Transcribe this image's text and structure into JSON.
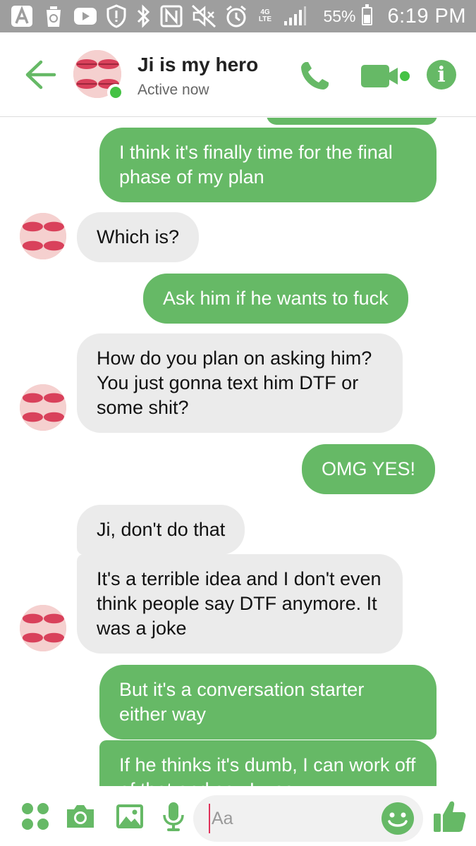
{
  "status_bar": {
    "battery_pct": "55%",
    "time": "6:19 PM",
    "network_label": "4G LTE"
  },
  "header": {
    "contact_name": "Ji is my hero",
    "contact_status": "Active now"
  },
  "messages": [
    {
      "side": "out",
      "text": "I think it's finally time for the final phase of my plan"
    },
    {
      "side": "in",
      "text": "Which is?"
    },
    {
      "side": "out",
      "text": "Ask him if he wants to fuck"
    },
    {
      "side": "in",
      "text": "How do you plan on asking him? You just gonna text him DTF or some shit?"
    },
    {
      "side": "out",
      "text": "OMG YES!"
    },
    {
      "side": "in",
      "text": "Ji, don't do that"
    },
    {
      "side": "in",
      "text": "It's a terrible idea and I don't even think people say DTF anymore. It was a joke"
    },
    {
      "side": "out",
      "text": "But it's a conversation starter either way"
    },
    {
      "side": "out",
      "text": "If he thinks it's dumb, I can work off of that and say I was"
    }
  ],
  "composer": {
    "placeholder": "Aa"
  },
  "colors": {
    "accent": "#66b966",
    "incoming_bubble": "#ebebeb",
    "status_bar": "#9e9e9e"
  },
  "icons": {
    "back": "arrow-left-icon",
    "call": "phone-icon",
    "video": "video-camera-icon",
    "info": "info-icon",
    "apps": "four-dots-icon",
    "camera": "camera-icon",
    "gallery": "image-icon",
    "voice": "microphone-icon",
    "emoji": "smiley-icon",
    "like": "thumbs-up-icon"
  }
}
